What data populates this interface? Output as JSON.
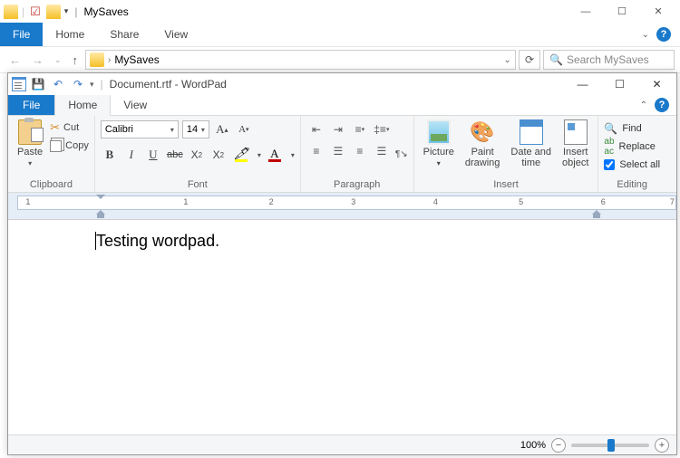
{
  "explorer": {
    "title": "MySaves",
    "tabs": {
      "file": "File",
      "home": "Home",
      "share": "Share",
      "view": "View"
    },
    "path_name": "MySaves",
    "search_placeholder": "Search MySaves"
  },
  "wordpad": {
    "title": "Document.rtf - WordPad",
    "tabs": {
      "file": "File",
      "home": "Home",
      "view": "View"
    },
    "groups": {
      "clipboard": {
        "label": "Clipboard",
        "paste": "Paste",
        "cut": "Cut",
        "copy": "Copy"
      },
      "font": {
        "label": "Font",
        "name": "Calibri",
        "size": "14"
      },
      "paragraph": {
        "label": "Paragraph"
      },
      "insert": {
        "label": "Insert",
        "picture": "Picture",
        "paint": "Paint\ndrawing",
        "date": "Date and\ntime",
        "object": "Insert\nobject"
      },
      "editing": {
        "label": "Editing",
        "find": "Find",
        "replace": "Replace",
        "selectall": "Select all"
      }
    },
    "ruler_numbers": [
      "1",
      "1",
      "2",
      "3",
      "4",
      "5",
      "6",
      "7"
    ],
    "document_text": "Testing wordpad.",
    "status": {
      "zoom": "100%"
    }
  }
}
